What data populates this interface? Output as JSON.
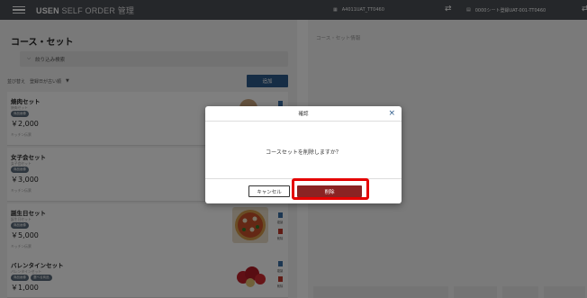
{
  "header": {
    "brand_bold": "USEN",
    "brand_light": " SELF ORDER 管理",
    "store_label": "A4011UAT_TT0460",
    "seat_label": "0000シート登録UAT-001-TT0460"
  },
  "left": {
    "title": "コース・セット",
    "filter_label": "絞り込み検索",
    "sort_prefix": "並び替え",
    "sort_value": "登録日が古い順",
    "add_button": "追加",
    "items": [
      {
        "name": "焼肉セット",
        "sub": "焼肉セット",
        "tags": [
          "商品画像"
        ],
        "price": "￥2,000",
        "kitchen": "キッチン伝票"
      },
      {
        "name": "女子会セット",
        "sub": "女子会セット",
        "tags": [
          "商品画像"
        ],
        "price": "￥3,000",
        "kitchen": "キッチン伝票"
      },
      {
        "name": "誕生日セット",
        "sub": "誕生日セット",
        "tags": [
          "商品画像"
        ],
        "price": "￥5,000",
        "kitchen": "キッチン伝票",
        "copy": "複製",
        "delete": "削除"
      },
      {
        "name": "バレンタインセット",
        "sub": "バレンタインセット",
        "tags": [
          "商品画像",
          "選べる商品"
        ],
        "price": "￥1,000",
        "copy": "複製",
        "delete": "削除"
      }
    ]
  },
  "right": {
    "title": "コース・セット情報"
  },
  "dialog": {
    "title": "確認",
    "message": "コースセットを削除しますか？",
    "cancel": "キャンセル",
    "delete": "削除"
  },
  "colors": {
    "header_bg": "#4a4e55",
    "primary": "#2c5a8a",
    "delete": "#8b2323",
    "highlight": "#e50000"
  }
}
